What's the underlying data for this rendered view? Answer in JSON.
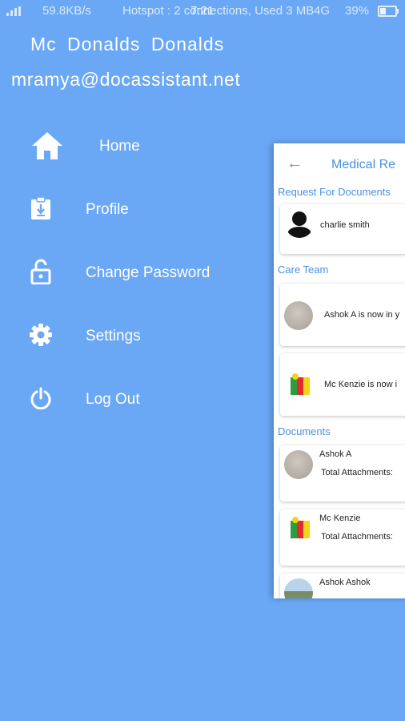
{
  "status_bar": {
    "speed": "59.8KB/s",
    "hotspot": "Hotspot : 2 connections, Used 3 MB",
    "time": "7:21",
    "network": "4G",
    "battery": "39%",
    "battery_level": 0.39
  },
  "drawer": {
    "user_name": "Mc  Donalds  Donalds",
    "email": "mramya@docassistant.net",
    "menu": [
      {
        "label": "Home",
        "icon": "home-icon"
      },
      {
        "label": "Profile",
        "icon": "profile-clipboard-icon"
      },
      {
        "label": "Change Password",
        "icon": "lock-icon"
      },
      {
        "label": "Settings",
        "icon": "gear-icon"
      },
      {
        "label": "Log Out",
        "icon": "power-icon"
      }
    ]
  },
  "main_preview": {
    "back_icon": "arrow-left-icon",
    "title": "Medical Re",
    "request_section": "Request For Documents",
    "request_name": "charlie smith",
    "care_team_section": "Care Team",
    "care_team": [
      {
        "text": "Ashok A is now in y",
        "avatar": "gray-avatar"
      },
      {
        "text": "Mc Kenzie is now i",
        "avatar": "flag-avatar"
      }
    ],
    "documents_section": "Documents",
    "documents": [
      {
        "name": "Ashok A",
        "attachments": "Total Attachments:",
        "avatar": "gray-avatar"
      },
      {
        "name": "Mc Kenzie",
        "attachments": "Total Attachments:",
        "avatar": "flag-avatar"
      },
      {
        "name": "Ashok Ashok",
        "attachments": "",
        "avatar": "landscape-avatar"
      }
    ]
  },
  "colors": {
    "background": "#6aa8f6",
    "accent": "#4a90e2",
    "text": "#ffffff"
  }
}
